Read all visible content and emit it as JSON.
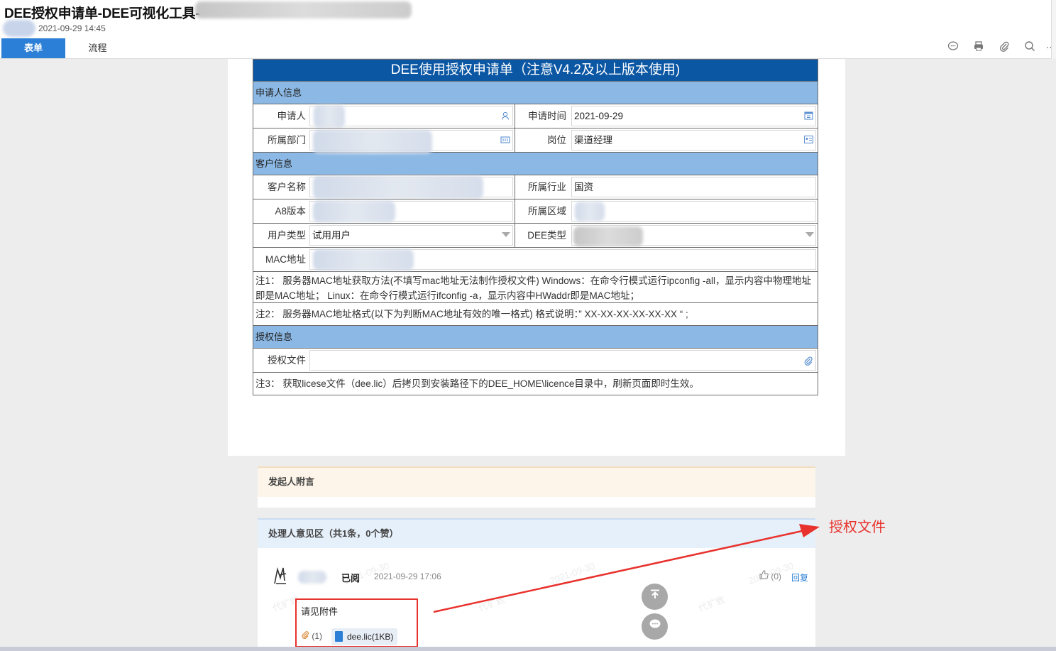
{
  "header": {
    "title": "DEE授权申请单-DEE可视化工具-",
    "timestamp": "2021-09-29 14:45",
    "tabs": [
      {
        "label": "表单",
        "active": true
      },
      {
        "label": "流程",
        "active": false
      }
    ],
    "toolbar_icons": [
      "comment-icon",
      "print-icon",
      "attachment-icon",
      "search-icon",
      "more-icon"
    ]
  },
  "form": {
    "title": "DEE使用授权申请单（注意V4.2及以上版本使用)",
    "sections": {
      "applicant": "申请人信息",
      "customer": "客户信息",
      "license": "授权信息"
    },
    "fields": {
      "applicant_label": "申请人",
      "apply_time_label": "申请时间",
      "apply_time_value": "2021-09-29",
      "department_label": "所属部门",
      "position_label": "岗位",
      "position_value": "渠道经理",
      "customer_name_label": "客户名称",
      "industry_label": "所属行业",
      "industry_value": "国资",
      "a8_version_label": "A8版本",
      "region_label": "所属区域",
      "user_type_label": "用户类型",
      "user_type_value": "试用用户",
      "dee_type_label": "DEE类型",
      "mac_label": "MAC地址",
      "license_file_label": "授权文件"
    },
    "notes": {
      "note1": "注1： 服务器MAC地址获取方法(不填写mac地址无法制作授权文件) Windows：在命令行模式运行ipconfig -all，显示内容中物理地址即是MAC地址； Linux：在命令行模式运行ifconfig -a，显示内容中HWaddr即是MAC地址；",
      "note2": "注2： 服务器MAC地址格式(以下为判断MAC地址有效的唯一格式) 格式说明：” XX-XX-XX-XX-XX-XX “ ;",
      "note3": "注3： 获取licese文件（dee.lic）后拷贝到安装路径下的DEE_HOME\\licence目录中，刷新页面即时生效。"
    }
  },
  "postscript": {
    "title": "发起人附言"
  },
  "opinions": {
    "title": "处理人意见区（共1条，0个赞）",
    "entries": [
      {
        "status": "已阅",
        "time": "2021-09-29 17:06",
        "likes": "(0)",
        "reply_label": "回复",
        "text": "请见附件",
        "attachment_count": "(1)",
        "attachment_name": "dee.lic(1KB)"
      }
    ]
  },
  "annotation": {
    "label": "授权文件",
    "color": "#e8322d"
  },
  "colors": {
    "form_header": "#0b57a4",
    "section_bg": "#8bb8e4",
    "tab_active": "#2c7fd6"
  }
}
